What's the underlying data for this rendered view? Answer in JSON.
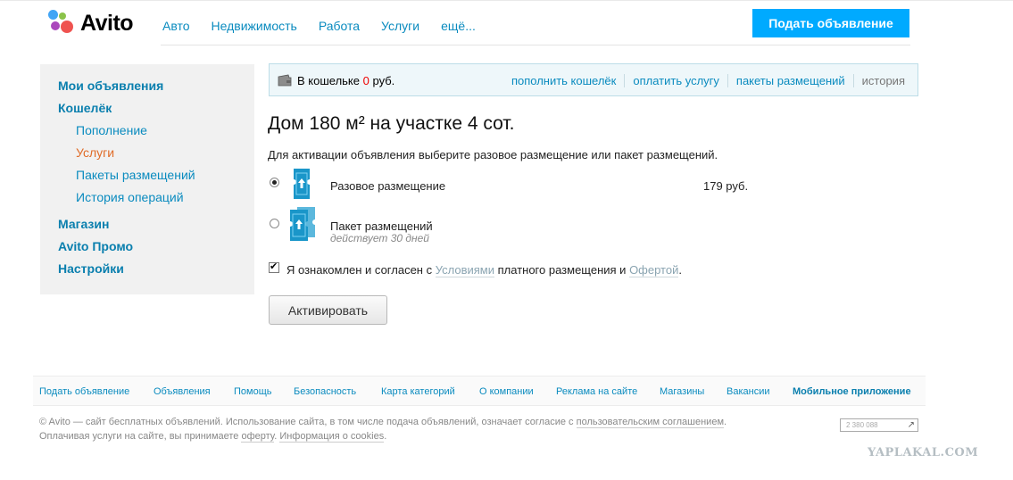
{
  "header": {
    "logo_text": "Avito",
    "nav": [
      "Авто",
      "Недвижимость",
      "Работа",
      "Услуги",
      "ещё..."
    ],
    "post_button": "Подать объявление"
  },
  "sidebar": {
    "my_ads": "Мои объявления",
    "wallet": "Кошелёк",
    "sub_items": [
      "Пополнение",
      "Услуги",
      "Пакеты размещений",
      "История операций"
    ],
    "shop": "Магазин",
    "promo": "Avito Промо",
    "settings": "Настройки"
  },
  "wallet_bar": {
    "prefix": "В кошельке",
    "amount": "0",
    "currency": "руб.",
    "links": [
      "пополнить кошелёк",
      "оплатить услугу",
      "пакеты размещений",
      "история"
    ]
  },
  "main": {
    "title": "Дом 180 м² на участке 4 сот.",
    "instruction": "Для активации объявления выберите разовое размещение или пакет размещений.",
    "option_single": {
      "label": "Разовое размещение",
      "price": "179 руб.",
      "selected": true
    },
    "option_package": {
      "label": "Пакет размещений",
      "note": "действует 30 дней",
      "selected": false
    },
    "agreement": {
      "text1": "Я ознакомлен и согласен с",
      "link1": "Условиями",
      "text2": "платного размещения и",
      "link2": "Офертой",
      "text3": ".",
      "checked": true
    },
    "activate_button": "Активировать"
  },
  "footer": {
    "links": [
      "Подать объявление",
      "Объявления",
      "Помощь",
      "Безопасность",
      "Карта категорий",
      "О компании",
      "Реклама на сайте",
      "Магазины",
      "Вакансии",
      "Мобильное приложение"
    ],
    "copy_line1": "© Avito — сайт бесплатных объявлений. Использование сайта, в том числе подача объявлений, означает согласие с",
    "copy_link1": "пользовательским соглашением",
    "copy_line1_end": ".",
    "copy_line2_a": "Оплачивая услуги на сайте, вы принимаете",
    "copy_link2": "оферту",
    "copy_line2_b": ".",
    "copy_link3": "Информация о cookies",
    "copy_line2_end": ".",
    "counter": "2 380 088"
  },
  "watermark": "YAPLAKAL.COM",
  "colors": {
    "accent": "#00aaff",
    "link": "#0a8bbf",
    "active": "#e06c28",
    "zero": "#ee0000"
  }
}
